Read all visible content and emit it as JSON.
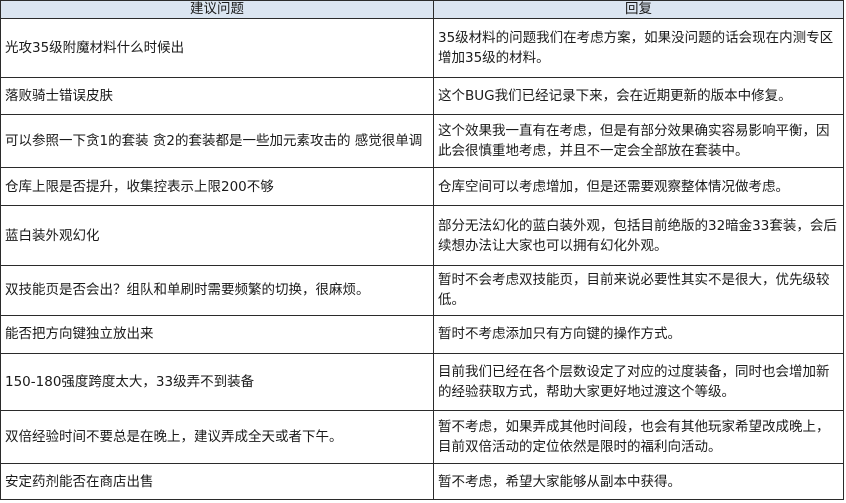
{
  "headers": {
    "question": "建议问题",
    "answer": "回复"
  },
  "rows": [
    {
      "question": "光攻35级附魔材料什么时候出",
      "answer": "35级材料的问题我们在考虑方案，如果没问题的话会现在内测专区增加35级的材料。"
    },
    {
      "question": "落败骑士错误皮肤",
      "answer": "这个BUG我们已经记录下来，会在近期更新的版本中修复。"
    },
    {
      "question": "可以参照一下贪1的套装 贪2的套装都是一些加元素攻击的 感觉很单调",
      "answer": "这个效果我一直有在考虑，但是有部分效果确实容易影响平衡，因此会很慎重地考虑，并且不一定会全部放在套装中。"
    },
    {
      "question": "仓库上限是否提升，收集控表示上限200不够",
      "answer": "仓库空间可以考虑增加，但是还需要观察整体情况做考虑。"
    },
    {
      "question": "蓝白装外观幻化",
      "answer": "部分无法幻化的蓝白装外观，包括目前绝版的32暗金33套装，会后续想办法让大家也可以拥有幻化外观。"
    },
    {
      "question": "双技能页是否会出？组队和单刷时需要频繁的切换，很麻烦。",
      "answer": "暂时不会考虑双技能页，目前来说必要性其实不是很大，优先级较低。"
    },
    {
      "question": "能否把方向键独立放出来",
      "answer": "暂时不考虑添加只有方向键的操作方式。"
    },
    {
      "question": "150-180强度跨度太大，33级弄不到装备",
      "answer": "目前我们已经在各个层数设定了对应的过度装备，同时也会增加新的经验获取方式，帮助大家更好地过渡这个等级。"
    },
    {
      "question": "双倍经验时间不要总是在晚上，建议弄成全天或者下午。",
      "answer": "暂不考虑，如果弄成其他时间段，也会有其他玩家希望改成晚上，目前双倍活动的定位依然是限时的福利向活动。"
    },
    {
      "question": "安定药剂能否在商店出售",
      "answer": "暂不考虑，希望大家能够从副本中获得。"
    }
  ]
}
